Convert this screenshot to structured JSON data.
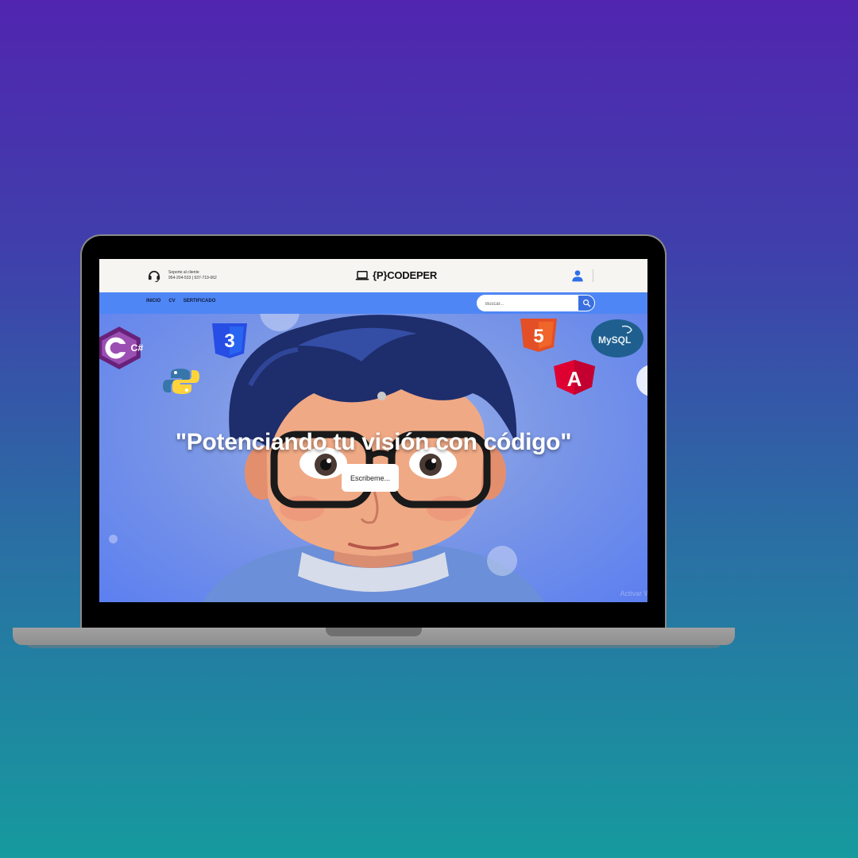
{
  "header": {
    "support_title": "Soporte al cliente",
    "support_phones": "954-204-533 | 937-719-062",
    "brand": "{P}CODEPER"
  },
  "nav": {
    "items": [
      {
        "label": "INICIO"
      },
      {
        "label": "CV"
      },
      {
        "label": "SERTIFICADO"
      }
    ],
    "search_placeholder": "Buscar..."
  },
  "hero": {
    "headline": "\"Potenciando tu visión con código\"",
    "button_label": "Escribeme...",
    "watermark": "Activar W"
  },
  "logos": {
    "csharp": "C#",
    "html5": "5",
    "css3": "3",
    "mysql": "MySQL",
    "angular": "A"
  },
  "colors": {
    "navbar": "#4f86f5",
    "search_button": "#3a6fe0",
    "topbar": "#f7f5f2",
    "background_top": "#5125b0",
    "background_bottom": "#169a9e"
  }
}
